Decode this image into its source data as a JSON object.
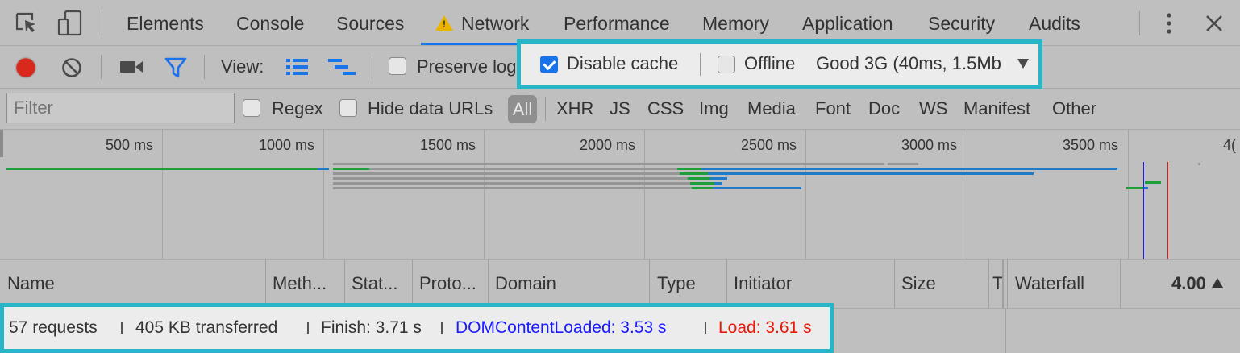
{
  "tabs": [
    {
      "label": "Elements",
      "active": false
    },
    {
      "label": "Console",
      "active": false
    },
    {
      "label": "Sources",
      "active": false
    },
    {
      "label": "Network",
      "active": true
    },
    {
      "label": "Performance",
      "active": false
    },
    {
      "label": "Memory",
      "active": false
    },
    {
      "label": "Application",
      "active": false
    },
    {
      "label": "Security",
      "active": false
    },
    {
      "label": "Audits",
      "active": false
    }
  ],
  "toolbar": {
    "view_label": "View:",
    "preserve_log_label": "Preserve log",
    "preserve_log_checked": false,
    "disable_cache_label": "Disable cache",
    "disable_cache_checked": true,
    "offline_label": "Offline",
    "offline_checked": false,
    "throttling_value": "Good 3G (40ms, 1.5Mb"
  },
  "filter": {
    "placeholder": "Filter",
    "regex_label": "Regex",
    "hide_data_urls_label": "Hide data URLs",
    "types": [
      "All",
      "XHR",
      "JS",
      "CSS",
      "Img",
      "Media",
      "Font",
      "Doc",
      "WS",
      "Manifest",
      "Other"
    ]
  },
  "timeline": {
    "ticks": [
      "500 ms",
      "1000 ms",
      "1500 ms",
      "2000 ms",
      "2500 ms",
      "3000 ms",
      "3500 ms",
      "4("
    ]
  },
  "columns": {
    "name": "Name",
    "method": "Meth...",
    "status": "Stat...",
    "protocol": "Proto...",
    "domain": "Domain",
    "type": "Type",
    "initiator": "Initiator",
    "size": "Size",
    "time": "T",
    "waterfall": "Waterfall",
    "waterfall_value": "4.00"
  },
  "summary": {
    "requests": "57 requests",
    "transferred": "405 KB transferred",
    "finish": "Finish: 3.71 s",
    "dom_content_loaded": "DOMContentLoaded: 3.53 s",
    "load": "Load: 3.61 s"
  },
  "colors": {
    "accent": "#1a73e8",
    "record": "#d9281c",
    "dom_content_loaded": "#1a1aff",
    "load": "#e8190c",
    "callout": "#29b5c8",
    "bar_green": "#1e9e3a",
    "bar_blue": "#1f7ac8",
    "bar_gray": "#959595"
  }
}
